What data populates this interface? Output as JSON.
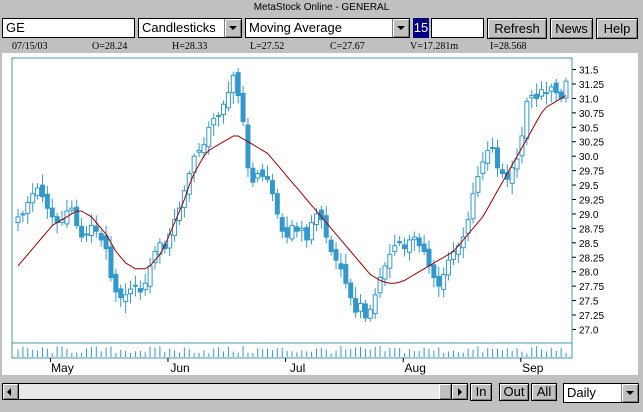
{
  "window": {
    "title": "MetaStock Online - GENERAL"
  },
  "toolbar": {
    "symbol_value": "GE",
    "chart_type": "Candlesticks",
    "indicator": "Moving Average",
    "period": "15",
    "refresh_label": "Refresh",
    "news_label": "News",
    "help_label": "Help"
  },
  "info": {
    "date": "07/15/03",
    "open": "O=28.24",
    "high": "H=28.33",
    "low": "L=27.52",
    "close": "C=27.67",
    "volume": "V=17.281m",
    "indicator": "I=28.568"
  },
  "bottom": {
    "in_label": "In",
    "out_label": "Out",
    "all_label": "All",
    "period_select": "Daily"
  },
  "colors": {
    "candle": "#3399cc",
    "moving_average": "#990000",
    "frame": "#4a9aa8"
  },
  "chart_data": {
    "type": "candlestick",
    "symbol": "GE",
    "x_labels": [
      "May",
      "Jun",
      "Jul",
      "Aug",
      "Sep"
    ],
    "y_ticks": [
      "27.0",
      "27.25",
      "27.5",
      "27.75",
      "28.0",
      "28.25",
      "28.5",
      "28.75",
      "29.0",
      "29.25",
      "29.5",
      "29.75",
      "30.0",
      "30.25",
      "30.5",
      "30.75",
      "31.0",
      "31.25",
      "31.5"
    ],
    "ylim": [
      26.8,
      31.7
    ],
    "close": [
      28.95,
      29.0,
      29.2,
      29.35,
      29.45,
      29.3,
      29.1,
      28.95,
      28.85,
      28.9,
      29.05,
      29.1,
      28.8,
      28.6,
      28.65,
      28.8,
      28.7,
      28.55,
      28.4,
      27.9,
      27.65,
      27.55,
      27.6,
      27.7,
      27.75,
      27.65,
      27.8,
      28.1,
      28.35,
      28.5,
      28.4,
      28.65,
      28.9,
      29.1,
      29.4,
      29.7,
      30.0,
      30.1,
      30.2,
      30.5,
      30.65,
      30.7,
      30.9,
      31.1,
      31.4,
      31.05,
      30.6,
      29.8,
      29.55,
      29.7,
      29.65,
      29.6,
      29.35,
      29.0,
      28.7,
      28.6,
      28.8,
      28.7,
      28.75,
      28.55,
      28.85,
      29.0,
      28.9,
      28.6,
      28.35,
      28.2,
      28.05,
      27.8,
      27.55,
      27.3,
      27.45,
      27.2,
      27.35,
      27.6,
      27.9,
      28.1,
      28.3,
      28.45,
      28.5,
      28.4,
      28.55,
      28.6,
      28.45,
      28.35,
      28.1,
      27.9,
      27.75,
      27.95,
      28.2,
      28.35,
      28.45,
      28.6,
      28.9,
      29.35,
      29.65,
      29.9,
      30.1,
      30.15,
      29.8,
      29.7,
      29.6,
      29.8,
      29.95,
      30.35,
      30.95,
      31.05,
      31.0,
      31.15,
      31.1,
      31.2,
      31.1,
      31.0,
      31.3
    ],
    "moving_average": [
      28.1,
      28.2,
      28.3,
      28.4,
      28.5,
      28.6,
      28.7,
      28.8,
      28.85,
      28.9,
      28.95,
      29.0,
      29.05,
      29.05,
      29.0,
      28.95,
      28.85,
      28.75,
      28.65,
      28.5,
      28.35,
      28.25,
      28.15,
      28.1,
      28.05,
      28.05,
      28.05,
      28.1,
      28.2,
      28.3,
      28.45,
      28.65,
      28.85,
      29.05,
      29.25,
      29.5,
      29.7,
      29.85,
      30.0,
      30.1,
      30.15,
      30.2,
      30.25,
      30.3,
      30.35,
      30.35,
      30.3,
      30.25,
      30.2,
      30.15,
      30.1,
      30.05,
      29.95,
      29.85,
      29.75,
      29.65,
      29.55,
      29.45,
      29.35,
      29.25,
      29.15,
      29.05,
      28.95,
      28.85,
      28.75,
      28.65,
      28.55,
      28.45,
      28.35,
      28.25,
      28.15,
      28.05,
      27.95,
      27.9,
      27.85,
      27.82,
      27.8,
      27.8,
      27.82,
      27.85,
      27.9,
      27.95,
      28.0,
      28.05,
      28.1,
      28.15,
      28.2,
      28.25,
      28.3,
      28.35,
      28.45,
      28.55,
      28.65,
      28.75,
      28.85,
      28.95,
      29.1,
      29.25,
      29.4,
      29.55,
      29.7,
      29.85,
      30.0,
      30.15,
      30.3,
      30.45,
      30.6,
      30.75,
      30.85,
      30.9,
      30.95,
      31.0,
      31.05
    ]
  }
}
